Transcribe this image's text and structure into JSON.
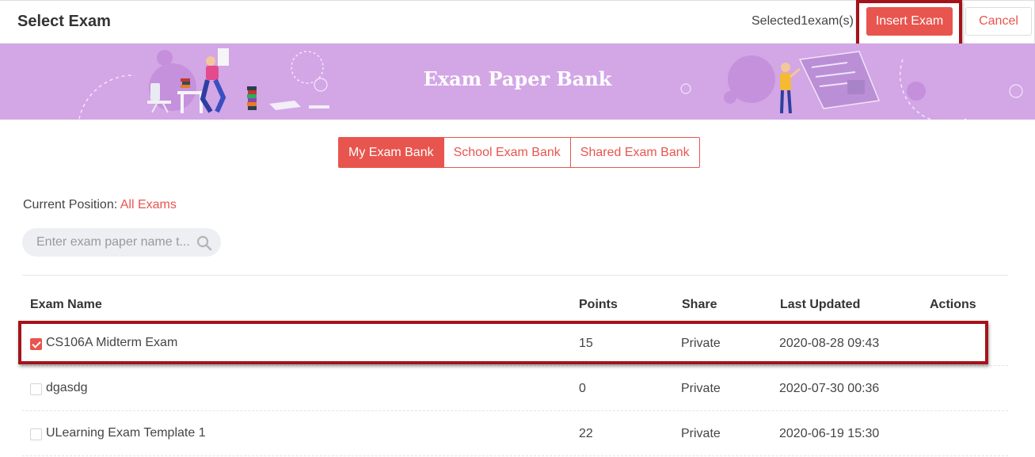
{
  "header": {
    "title": "Select Exam",
    "selected_text": "Selected1exam(s)",
    "insert_label": "Insert Exam",
    "cancel_label": "Cancel"
  },
  "banner": {
    "title": "Exam Paper Bank"
  },
  "tabs": [
    {
      "label": "My Exam Bank",
      "active": true
    },
    {
      "label": "School Exam Bank",
      "active": false
    },
    {
      "label": "Shared Exam Bank",
      "active": false
    }
  ],
  "position": {
    "label": "Current Position:",
    "value": "All Exams"
  },
  "search": {
    "placeholder": "Enter exam paper name t..."
  },
  "table": {
    "headers": {
      "name": "Exam Name",
      "points": "Points",
      "share": "Share",
      "updated": "Last Updated",
      "actions": "Actions"
    },
    "rows": [
      {
        "name": "CS106A Midterm Exam",
        "points": "15",
        "share": "Private",
        "updated": "2020-08-28 09:43",
        "checked": true
      },
      {
        "name": "dgasdg",
        "points": "0",
        "share": "Private",
        "updated": "2020-07-30 00:36",
        "checked": false
      },
      {
        "name": "ULearning Exam Template 1",
        "points": "22",
        "share": "Private",
        "updated": "2020-06-19 15:30",
        "checked": false
      }
    ]
  },
  "colors": {
    "accent": "#e8554e",
    "banner": "#d3a6e6",
    "highlight": "#a4131a"
  }
}
